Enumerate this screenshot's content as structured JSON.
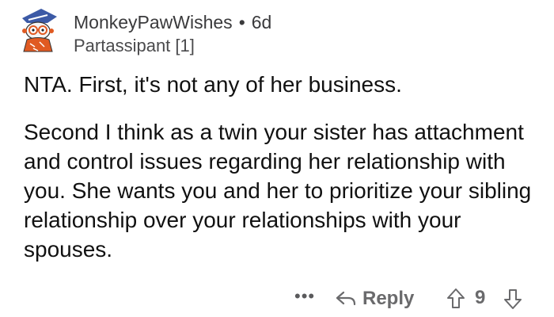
{
  "comment": {
    "username": "MonkeyPawWishes",
    "separator": "•",
    "age": "6d",
    "flair": "Partassipant [1]",
    "paragraphs": [
      "NTA.  First, it's not any of her business.",
      "Second I think as a twin your sister has attachment and control issues regarding her relationship with you. She wants you and her to prioritize your sibling relationship over your relationships with your spouses."
    ],
    "avatar_icon": "snoo-avatar-icon"
  },
  "actions": {
    "more_label": "•••",
    "reply_label": "Reply",
    "vote_count": "9"
  }
}
